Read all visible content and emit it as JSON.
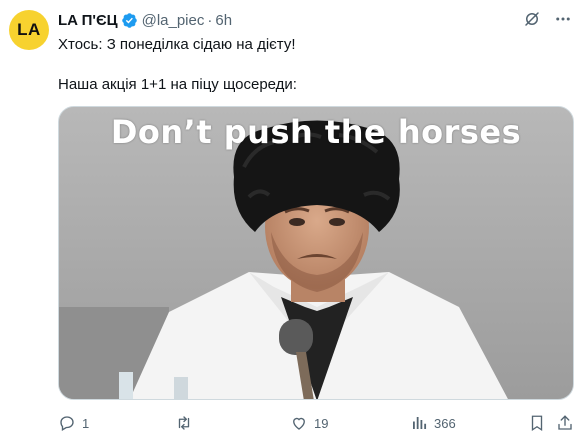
{
  "tweet": {
    "avatar_text": "LA",
    "display_name": "LA П'ЄЦ",
    "handle": "@la_piec",
    "separator": "·",
    "time": "6h",
    "text_line1": "Хтось: З понеділка сідаю на дієту!",
    "text_line2": "Наша акція 1+1 на піцу щосереди:",
    "media": {
      "caption": "Don’t push the horses"
    },
    "actions": {
      "replies": "1",
      "likes": "19",
      "views": "366"
    }
  },
  "colors": {
    "avatar_bg": "#f7d22f",
    "verified": "#1d9bf0",
    "secondary_text": "#536471"
  },
  "icons": [
    "verified-badge-icon",
    "grok-icon",
    "more-icon",
    "reply-icon",
    "retweet-icon",
    "like-icon",
    "views-icon",
    "bookmark-icon",
    "share-icon"
  ]
}
